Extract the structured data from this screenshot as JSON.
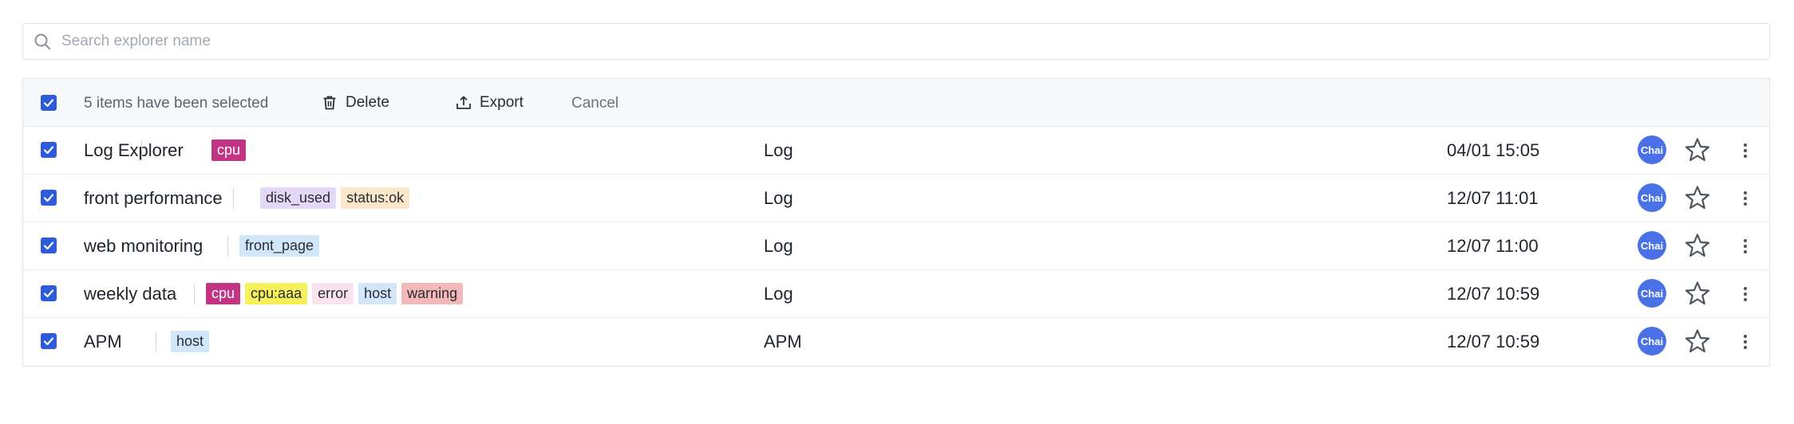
{
  "search": {
    "placeholder": "Search explorer name",
    "value": ""
  },
  "toolbar": {
    "selected_text": "5 items have been selected",
    "delete_label": "Delete",
    "export_label": "Export",
    "cancel_label": "Cancel"
  },
  "colors": {
    "accent": "#2e5bd9",
    "avatar_bg": "#4a72e6"
  },
  "rows": [
    {
      "name": "Log Explorer",
      "type": "Log",
      "date": "04/01 15:05",
      "avatar": "Chai",
      "checked": true,
      "tags": [
        {
          "label": "cpu",
          "bg": "#c13584",
          "color": "#ffffff"
        }
      ]
    },
    {
      "name": "front performance",
      "type": "Log",
      "date": "12/07 11:01",
      "avatar": "Chai",
      "checked": true,
      "tags": [
        {
          "label": "disk_used",
          "bg": "#e4d8f7",
          "color": "#2b2b33"
        },
        {
          "label": "status:ok",
          "bg": "#fbe7c9",
          "color": "#2b2b33"
        }
      ]
    },
    {
      "name": "web monitoring",
      "type": "Log",
      "date": "12/07 11:00",
      "avatar": "Chai",
      "checked": true,
      "tags": [
        {
          "label": "front_page",
          "bg": "#d2e6fb",
          "color": "#2b2b33"
        }
      ]
    },
    {
      "name": "weekly data",
      "type": "Log",
      "date": "12/07 10:59",
      "avatar": "Chai",
      "checked": true,
      "tags": [
        {
          "label": "cpu",
          "bg": "#c13584",
          "color": "#ffffff"
        },
        {
          "label": "cpu:aaa",
          "bg": "#f6f05a",
          "color": "#2b2b33"
        },
        {
          "label": "error",
          "bg": "#fbe2ef",
          "color": "#2b2b33"
        },
        {
          "label": "host",
          "bg": "#d2e6fb",
          "color": "#2b2b33"
        },
        {
          "label": "warning",
          "bg": "#f3b8b8",
          "color": "#2b2b33"
        }
      ]
    },
    {
      "name": "APM",
      "type": "APM",
      "date": "12/07 10:59",
      "avatar": "Chai",
      "checked": true,
      "tags": [
        {
          "label": "host",
          "bg": "#d2e6fb",
          "color": "#2b2b33"
        }
      ]
    }
  ]
}
